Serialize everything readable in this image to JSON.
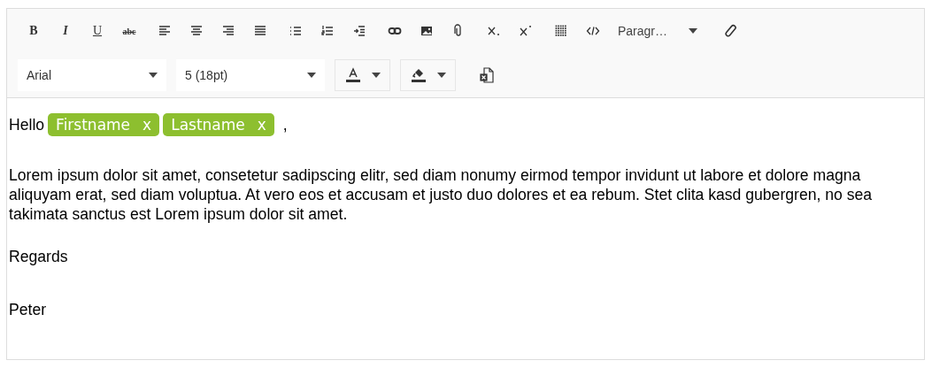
{
  "toolbar": {
    "buttons": [
      {
        "kind": "bold",
        "label": "B"
      },
      {
        "kind": "italic",
        "label": "I"
      },
      {
        "kind": "underline",
        "label": "U"
      },
      {
        "kind": "strike",
        "label": "abc"
      },
      {
        "kind": "align-left"
      },
      {
        "kind": "align-center"
      },
      {
        "kind": "align-right"
      },
      {
        "kind": "justify"
      },
      {
        "kind": "bullets"
      },
      {
        "kind": "numbers"
      },
      {
        "kind": "indent"
      },
      {
        "kind": "link"
      },
      {
        "kind": "image"
      },
      {
        "kind": "attach"
      },
      {
        "kind": "subscript"
      },
      {
        "kind": "superscript"
      },
      {
        "kind": "table"
      },
      {
        "kind": "code"
      },
      {
        "kind": "format",
        "label": "Paragr…"
      },
      {
        "kind": "clear"
      }
    ],
    "font": "Arial",
    "size": "5 (18pt)"
  },
  "content": {
    "greeting": "Hello",
    "chips": [
      {
        "label": "Firstname",
        "remove": "x"
      },
      {
        "label": "Lastname",
        "remove": "x"
      }
    ],
    "after_chips": ",",
    "paragraphs": [
      "Lorem ipsum dolor sit amet, consetetur sadipscing elitr, sed diam nonumy eirmod tempor invidunt ut labore et dolore magna aliquyam erat, sed diam voluptua. At vero eos et accusam et justo duo dolores et ea rebum. Stet clita kasd gubergren, no sea takimata sanctus est Lorem ipsum dolor sit amet.",
      "Regards",
      "Peter"
    ]
  }
}
